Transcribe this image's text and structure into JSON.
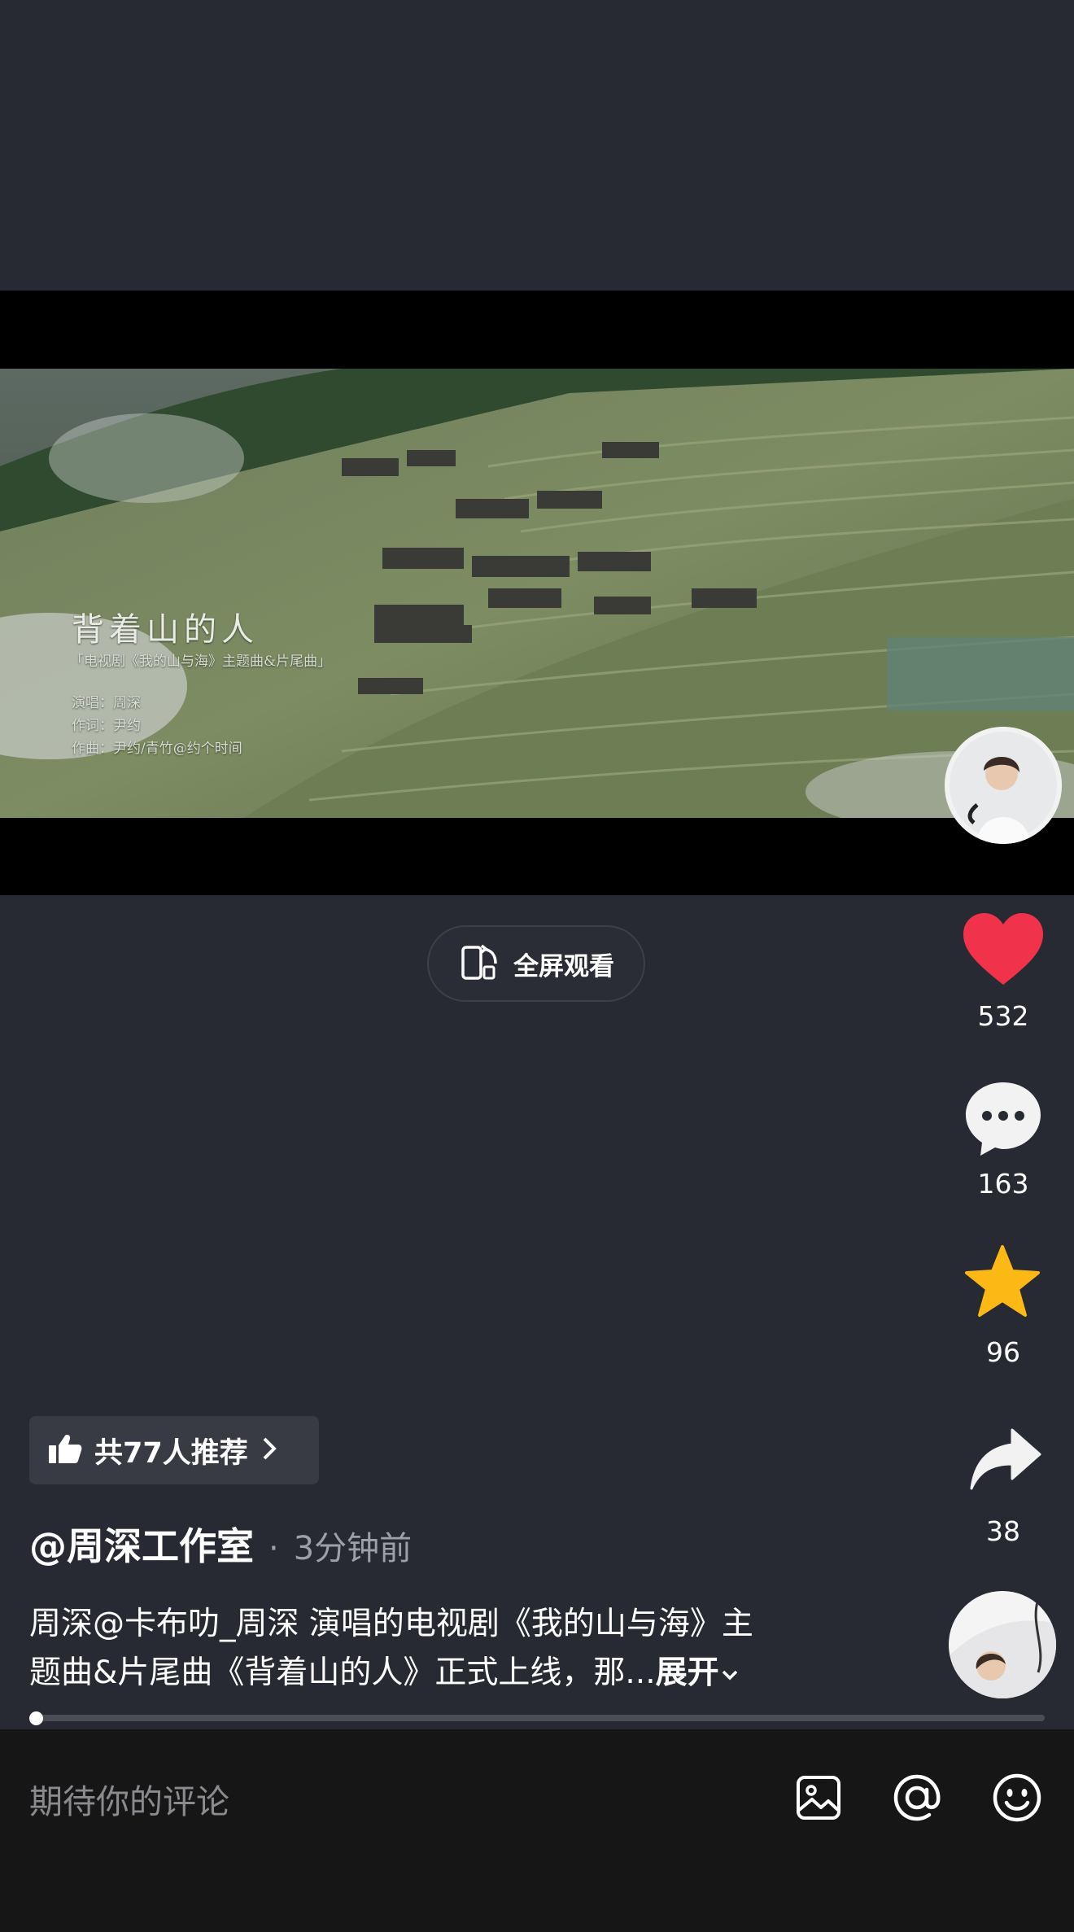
{
  "video": {
    "overlay_title": "背着山的人",
    "overlay_subtitle": "「电视剧《我的山与海》主题曲&片尾曲」",
    "overlay_lines": [
      "演唱：周深",
      "作词：尹约",
      "作曲：尹约/青竹@约个时间"
    ]
  },
  "fullscreen": {
    "label": "全屏观看",
    "icon": "rotate-phone-icon"
  },
  "actions": {
    "like": {
      "count": "532",
      "icon": "heart-icon",
      "color": "#f0324b"
    },
    "comment": {
      "count": "163",
      "icon": "comment-bubble-icon"
    },
    "favorite": {
      "count": "96",
      "icon": "star-icon",
      "color": "#fcb814"
    },
    "share": {
      "count": "38",
      "icon": "share-arrow-icon"
    }
  },
  "recommend": {
    "text": "共77人推荐",
    "icon": "thumbs-up-icon"
  },
  "post": {
    "author": "@周深工作室",
    "separator": "·",
    "time": "3分钟前",
    "caption_line1": "周深@卡布叻_周深 演唱的电视剧《我的山与海》主",
    "caption_line2": "题曲&片尾曲《背着山的人》正式上线，那...",
    "expand_label": "展开"
  },
  "progress": {
    "fraction": 0.0
  },
  "comment_bar": {
    "placeholder": "期待你的评论",
    "icons": [
      "image-icon",
      "at-icon",
      "emoji-icon"
    ]
  }
}
